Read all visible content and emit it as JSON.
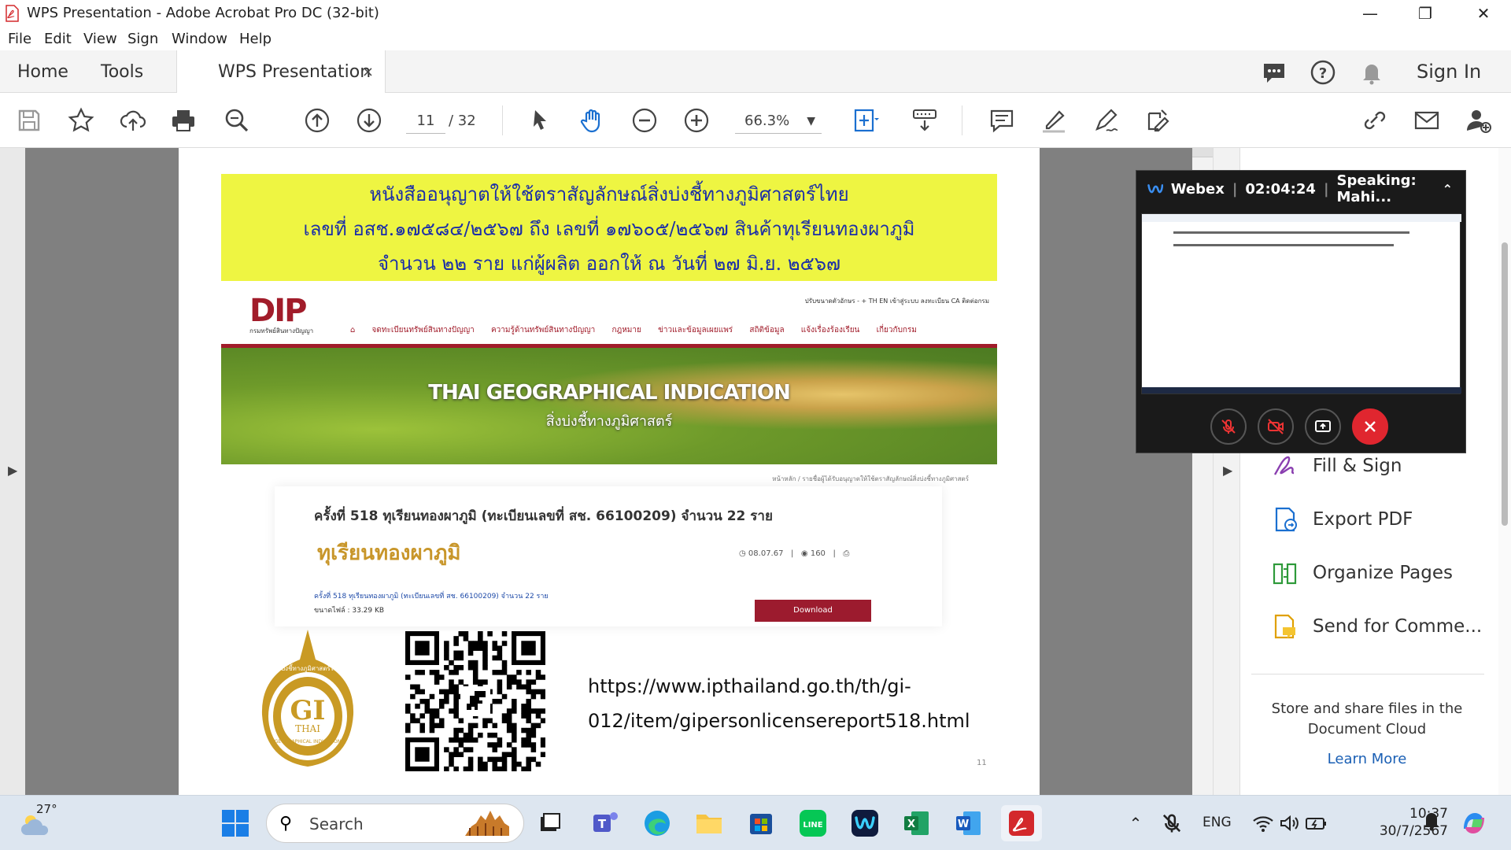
{
  "window": {
    "title": "WPS Presentation - Adobe Acrobat Pro DC (32-bit)"
  },
  "menu": [
    "File",
    "Edit",
    "View",
    "Sign",
    "Window",
    "Help"
  ],
  "tabs": {
    "home": "Home",
    "tools": "Tools",
    "doc": "WPS Presentation",
    "close": "×",
    "sign_in": "Sign In"
  },
  "toolbar": {
    "page_current": "11",
    "page_total": "/ 32",
    "zoom": "66.3%"
  },
  "slide": {
    "banner_lines": [
      "หนังสืออนุญาตให้ใช้ตราสัญลักษณ์สิ่งบ่งชี้ทางภูมิศาสตร์ไทย",
      "เลขที่ อสช.๑๗๕๘๔/๒๕๖๗ ถึง เลขที่ ๑๗๖๐๕/๒๕๖๗ สินค้าทุเรียนทองผาภูมิ",
      "จำนวน ๒๒ ราย แก่ผู้ผลิต ออกให้ ณ วันที่ ๒๗ มิ.ย. ๒๕๖๗"
    ],
    "dip_logo": "DIP",
    "dip_logo_sub": "กรมทรัพย์สินทางปัญญา",
    "dip_topnav": "ปรับขนาดตัวอักษร  -  +   TH  EN   เข้าสู่ระบบ   ลงทะเบียน CA   ติดต่อกรม",
    "dip_nav": [
      "จดทะเบียนทรัพย์สินทางปัญญา",
      "ความรู้ด้านทรัพย์สินทางปัญญา",
      "กฎหมาย",
      "ข่าวและข้อมูลเผยแพร่",
      "สถิติข้อมูล",
      "แจ้งเรื่องร้องเรียน",
      "เกี่ยวกับกรม"
    ],
    "hero_title": "THAI GEOGRAPHICAL INDICATION",
    "hero_sub": "สิ่งบ่งชี้ทางภูมิศาสตร์",
    "breadcrumb": "หน้าหลัก / รายชื่อผู้ได้รับอนุญาตให้ใช้ตราสัญลักษณ์สิ่งบ่งชี้ทางภูมิศาสตร์",
    "card_heading": "ครั้งที่ 518 ทุเรียนทองผาภูมิ (ทะเบียนเลขที่ สช. 66100209) จำนวน 22 ราย",
    "card_gold": "ทุเรียนทองผาภูมิ",
    "card_date": "08.07.67",
    "card_views": "160",
    "card_link": "ครั้งที่ 518 ทุเรียนทองผาภูมิ (ทะเบียนเลขที่ สช. 66100209) จำนวน 22 ราย",
    "card_size": "ขนาดไฟล์ :  33.29 KB",
    "download": "Download",
    "gi_logo_text": "สิ่งบ่งชี้ทางภูมิศาสตร์ไทย",
    "gi_logo_mark": "GI",
    "gi_logo_thai": "THAI",
    "gi_logo_en": "GEOGRAPHICAL INDICATION",
    "url_line1": "https://www.ipthailand.go.th/th/gi-",
    "url_line2": "012/item/gipersonlicensereport518.html",
    "page_number": "11"
  },
  "right_pane": {
    "tools": [
      "Fill & Sign",
      "Export PDF",
      "Organize Pages",
      "Send for Comme..."
    ],
    "cloud_text": "Store and share files in the Document Cloud",
    "learn_more": "Learn More"
  },
  "webex": {
    "brand": "Webex",
    "timer": "02:04:24",
    "speaking": "Speaking: Mahi..."
  },
  "taskbar": {
    "temp": "27°",
    "search": "Search",
    "lang": "ENG",
    "time": "10:37",
    "date": "30/7/2567"
  },
  "colors": {
    "accent": "#a11c2a",
    "banner_bg": "#eef542",
    "banner_text": "#1b2ea8",
    "end_call": "#e0262f",
    "link": "#1a5fb4"
  }
}
